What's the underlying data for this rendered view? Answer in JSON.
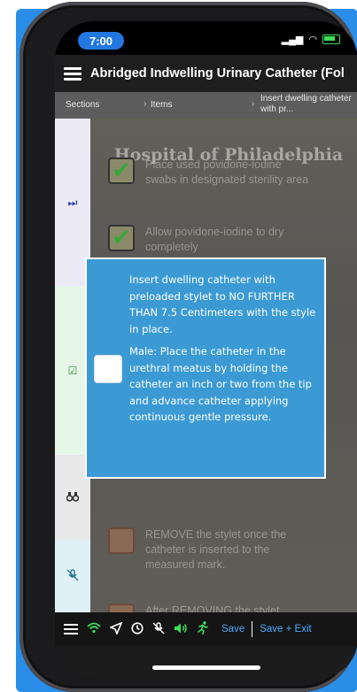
{
  "status": {
    "time": "7:00"
  },
  "app": {
    "title": "Abridged Indwelling Urinary Catheter (Fol"
  },
  "breadcrumb": {
    "sections": "Sections",
    "items": "Items",
    "current": "Insert dwelling catheter with pr..."
  },
  "sidebar": {
    "icons": [
      "skip-icon",
      "checkbox-icon",
      "binoculars-icon",
      "mic-off-icon"
    ]
  },
  "background_rows": [
    {
      "text": "Place used povidone-iodine swabs in designated sterility area",
      "state": "checked"
    },
    {
      "text": "Allow povidone-iodine to dry completely",
      "state": "checked"
    },
    {
      "text": "REMOVE the stylet once the catheter is inserted to the measured mark.",
      "state": "pending"
    },
    {
      "text": "After REMOVING the stylet, advance",
      "state": "pending"
    }
  ],
  "watermark": "Hospital of Philadelphia",
  "modal": {
    "paragraph1": "Insert dwelling catheter with preloaded stylet to NO FURTHER THAN 7.5 Centimeters with the style in place.",
    "paragraph2": "Male: Place the catheter in the urethral meatus by holding the catheter an inch or two from the tip and advance catheter applying continuous gentle pressure."
  },
  "toolbar": {
    "save": "Save",
    "save_exit": "Save + Exit"
  },
  "colors": {
    "modal_bg": "#3b9ad4",
    "accent_green": "#3ee05a",
    "link_blue": "#4aa8ff"
  }
}
